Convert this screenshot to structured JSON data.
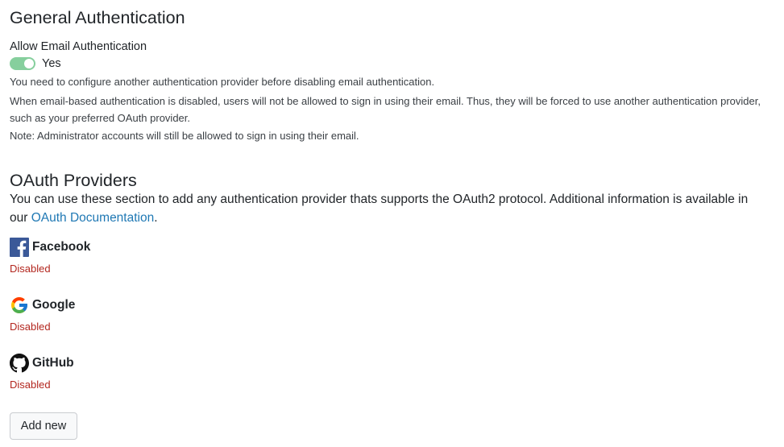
{
  "general": {
    "title": "General Authentication",
    "allow_email_label": "Allow Email Authentication",
    "toggle_on": true,
    "toggle_label": "Yes",
    "help_text_1": "You need to configure another authentication provider before disabling email authentication.",
    "help_text_2": "When email-based authentication is disabled, users will not be allowed to sign in using their email. Thus, they will be forced to use another authentication provider, such as your preferred OAuth provider.",
    "help_text_3": "Note: Administrator accounts will still be allowed to sign in using their email."
  },
  "oauth": {
    "title": "OAuth Providers",
    "description_before_link": "You can use these section to add any authentication provider thats supports the OAuth2 protocol. Additional information is available in our ",
    "doc_link_text": "OAuth Documentation",
    "description_after_link": ".",
    "providers": [
      {
        "name": "Facebook",
        "status": "Disabled",
        "icon": "facebook-icon"
      },
      {
        "name": "Google",
        "status": "Disabled",
        "icon": "google-icon"
      },
      {
        "name": "GitHub",
        "status": "Disabled",
        "icon": "github-icon"
      }
    ],
    "add_button_label": "Add new"
  },
  "colors": {
    "toggle_on": "#86cf9d",
    "link": "#1f78b4",
    "status_disabled": "#b3261e",
    "facebook_brand": "#3b5998"
  }
}
